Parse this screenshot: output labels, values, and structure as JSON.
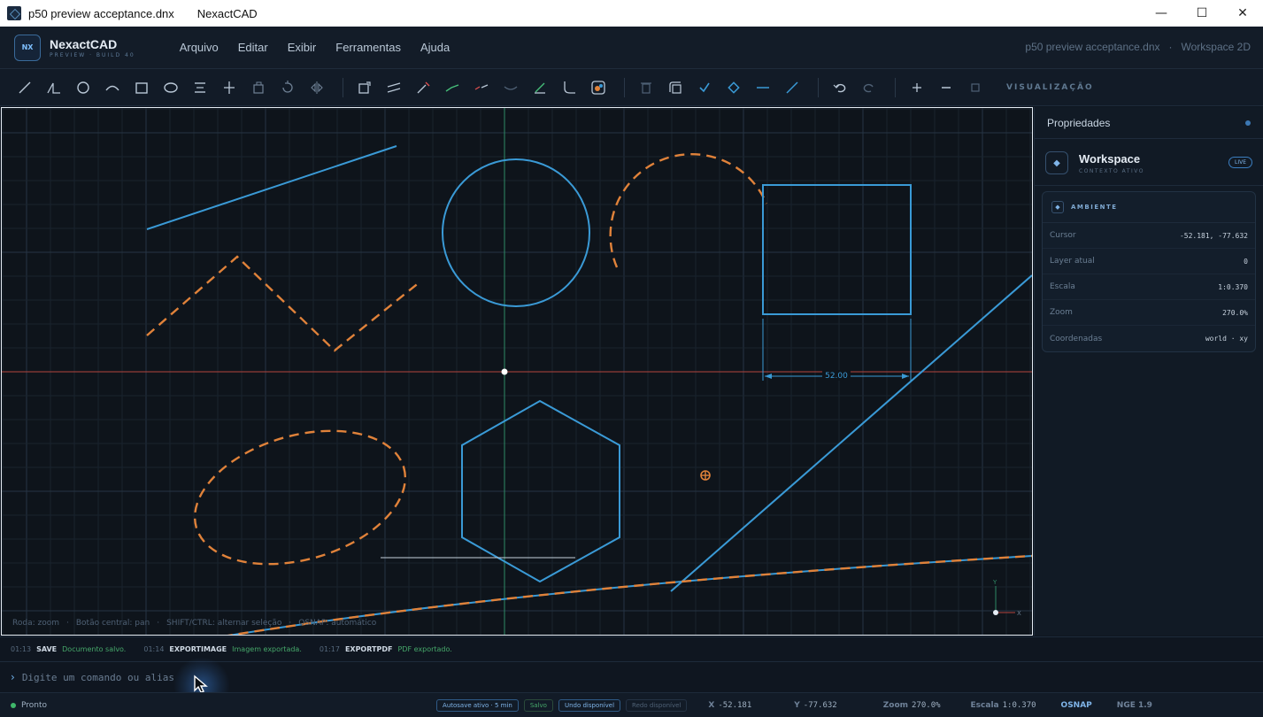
{
  "window": {
    "file_title": "p50 preview acceptance.dnx",
    "app_title": "NexactCAD",
    "minimize": "—",
    "maximize": "☐",
    "close": "✕"
  },
  "brand": {
    "badge": "NX",
    "name": "NexactCAD",
    "subtitle": "PREVIEW · BUILD 40"
  },
  "menu": {
    "items": [
      "Arquivo",
      "Editar",
      "Exibir",
      "Ferramentas",
      "Ajuda"
    ]
  },
  "breadcrumb": {
    "file": "p50 preview acceptance.dnx",
    "separator": "·",
    "workspace": "Workspace 2D"
  },
  "toolbar": {
    "section_label": "VISUALIZAÇÃO"
  },
  "canvas": {
    "hint_zoom": "Roda: zoom",
    "hint_pan": "Botão central: pan",
    "hint_select": "SHIFT/CTRL: alternar seleção",
    "hint_osnap": "OSNAP: automático",
    "hint_sep": "·",
    "dimension_text": "52.00",
    "axis_x": "X",
    "axis_y": "Y",
    "colors": {
      "blue": "#3a9ad6",
      "orange": "#e0823a",
      "grid": "#1f2a36",
      "axis_red": "#b4453d",
      "axis_green": "#2f8a66"
    }
  },
  "properties": {
    "title": "Propriedades",
    "workspace_name": "Workspace",
    "workspace_sub": "CONTEXTO ATIVO",
    "workspace_badge": "LIVE",
    "env_title": "AMBIENTE",
    "rows": [
      {
        "key": "Cursor",
        "value": "-52.181, -77.632"
      },
      {
        "key": "Layer atual",
        "value": "0"
      },
      {
        "key": "Escala",
        "value": "1:0.370"
      },
      {
        "key": "Zoom",
        "value": "270.0%"
      },
      {
        "key": "Coordenadas",
        "value": "world · xy"
      }
    ]
  },
  "log": {
    "entries": [
      {
        "time": "01:13",
        "cmd": "SAVE",
        "msg": "Documento salvo."
      },
      {
        "time": "01:14",
        "cmd": "EXPORTIMAGE",
        "msg": "Imagem exportada."
      },
      {
        "time": "01:17",
        "cmd": "EXPORTPDF",
        "msg": "PDF exportado."
      }
    ]
  },
  "command": {
    "prompt": "›",
    "placeholder": "Digite um comando ou alias"
  },
  "status": {
    "mode": "Pronto",
    "autosave": "Autosave ativo · 5 min",
    "saved": "Salvo",
    "undo": "Undo disponível",
    "redo": "Redo disponível",
    "x_label": "X",
    "x_value": "-52.181",
    "y_label": "Y",
    "y_value": "-77.632",
    "zoom_label": "Zoom",
    "zoom_value": "270.0%",
    "scale_label": "Escala",
    "scale_value": "1:0.370",
    "osnap": "OSNAP",
    "version": "NGE 1.9"
  }
}
